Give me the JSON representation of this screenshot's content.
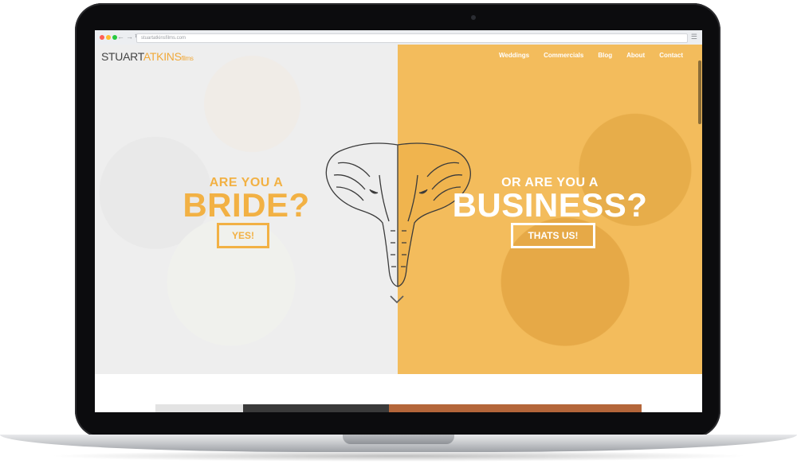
{
  "browser": {
    "url": "stuartatkinsfilms.com",
    "back_icon": "back-arrow-icon",
    "forward_icon": "forward-arrow-icon",
    "reload_icon": "reload-icon",
    "menu_icon": "menu-icon"
  },
  "site": {
    "logo": {
      "part1": "STUART",
      "part2": "ATKINS",
      "part3": "films"
    },
    "nav": [
      "Weddings",
      "Commercials",
      "Blog",
      "About",
      "Contact"
    ],
    "left_panel": {
      "heading_small": "ARE YOU A",
      "heading_big": "BRIDE?",
      "button": "YES!"
    },
    "right_panel": {
      "heading_small": "OR ARE YOU A",
      "heading_big": "BUSINESS?",
      "button": "THATS US!"
    },
    "scroll_icon": "chevron-down-icon"
  },
  "colors": {
    "accent": "#f2b144",
    "right_panel_bg": "#f3bc5c",
    "laptop_bezel": "#0c0c0e"
  }
}
